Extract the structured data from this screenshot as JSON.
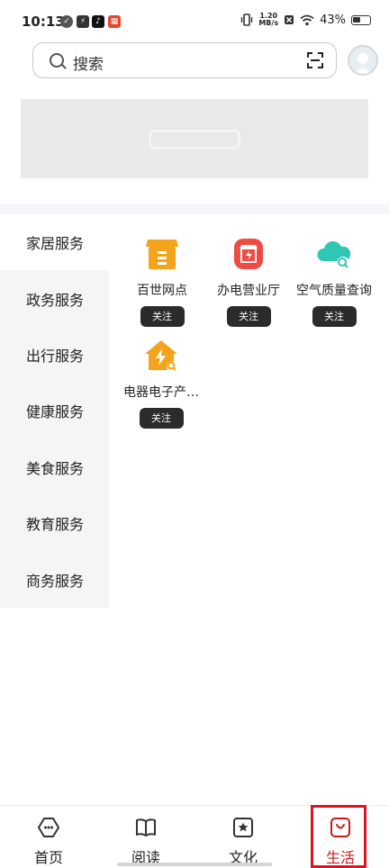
{
  "status_bar": {
    "time": "10:13",
    "net_speed_value": "1.20",
    "net_speed_unit": "MB/s",
    "battery": "43%"
  },
  "search": {
    "placeholder": "搜索"
  },
  "categories": [
    {
      "label": "家居服务",
      "active": true
    },
    {
      "label": "政务服务",
      "active": false
    },
    {
      "label": "出行服务",
      "active": false
    },
    {
      "label": "健康服务",
      "active": false
    },
    {
      "label": "美食服务",
      "active": false
    },
    {
      "label": "教育服务",
      "active": false
    },
    {
      "label": "商务服务",
      "active": false
    }
  ],
  "services": [
    {
      "name": "百世网点",
      "follow_label": "关注",
      "icon": "courier-box-icon",
      "color": "#f5a31a"
    },
    {
      "name": "办电营业厅",
      "follow_label": "关注",
      "icon": "power-store-icon",
      "color": "#ef4b44"
    },
    {
      "name": "空气质量查询",
      "follow_label": "关注",
      "icon": "air-cloud-icon",
      "color": "#2fc6b4"
    },
    {
      "name": "电器电子产…",
      "follow_label": "关注",
      "icon": "appliance-house-icon",
      "color": "#f5a31a"
    }
  ],
  "bottom_nav": [
    {
      "label": "首页",
      "icon": "home-hexagon-icon",
      "active": false
    },
    {
      "label": "阅读",
      "icon": "book-icon",
      "active": false
    },
    {
      "label": "文化",
      "icon": "star-frame-icon",
      "active": false
    },
    {
      "label": "生活",
      "icon": "shopping-bag-icon",
      "active": true
    }
  ],
  "colors": {
    "accent": "#c8191f",
    "highlight_box": "#e0131f",
    "follow_button": "#2b2b2b"
  }
}
